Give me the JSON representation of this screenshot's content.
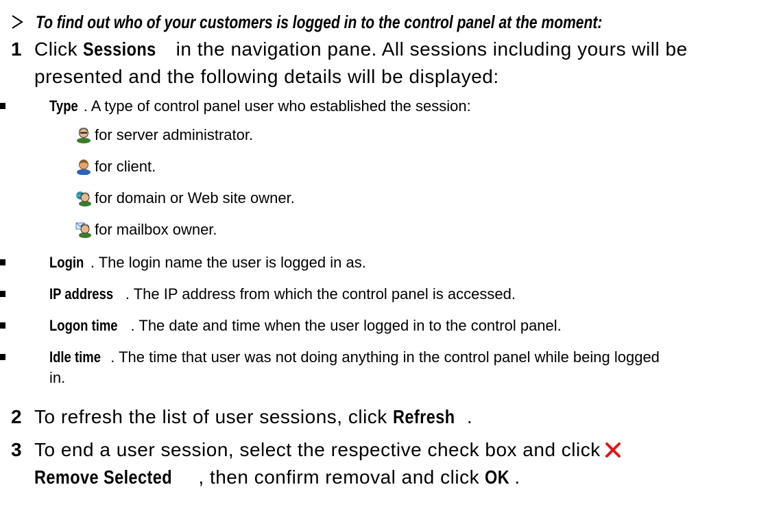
{
  "procedure": {
    "title": "To find out who of your customers is logged in to the control panel at the moment:",
    "bullet_icon": "arrow-bullet-icon"
  },
  "steps": [
    {
      "number": "1",
      "pre": "Click ",
      "button": "Sessions",
      "post": " in the navigation pane. All sessions including yours will be presented and the following details will be displayed:"
    },
    {
      "number": "2",
      "pre": "To refresh the list of user sessions, click ",
      "button": "Refresh",
      "post": "."
    },
    {
      "number": "3",
      "pre": "To end a user session, select the respective check box and click",
      "remove_icon": "red-x-icon",
      "button": "Remove Selected",
      "mid": ", then confirm removal and click ",
      "button2": "OK",
      "post": "."
    }
  ],
  "details": [
    {
      "term": "Type",
      "text": ". A type of control panel user who established the session:"
    },
    {
      "term": "Login",
      "text": ". The login name the user is logged in as."
    },
    {
      "term": "IP address",
      "text": ". The IP address from which the control panel is accessed."
    },
    {
      "term": "Logon time",
      "text": ". The date and time when the user logged in to the control panel."
    },
    {
      "term": "Idle time",
      "text": ". The time that user was not doing anything in the control panel while being logged in."
    }
  ],
  "user_types": [
    {
      "icon": "server-administrator-icon",
      "label": "for server administrator."
    },
    {
      "icon": "client-icon",
      "label": "for client."
    },
    {
      "icon": "domain-owner-icon",
      "label": "for domain or Web site owner."
    },
    {
      "icon": "mailbox-owner-icon",
      "label": "for mailbox owner."
    }
  ]
}
